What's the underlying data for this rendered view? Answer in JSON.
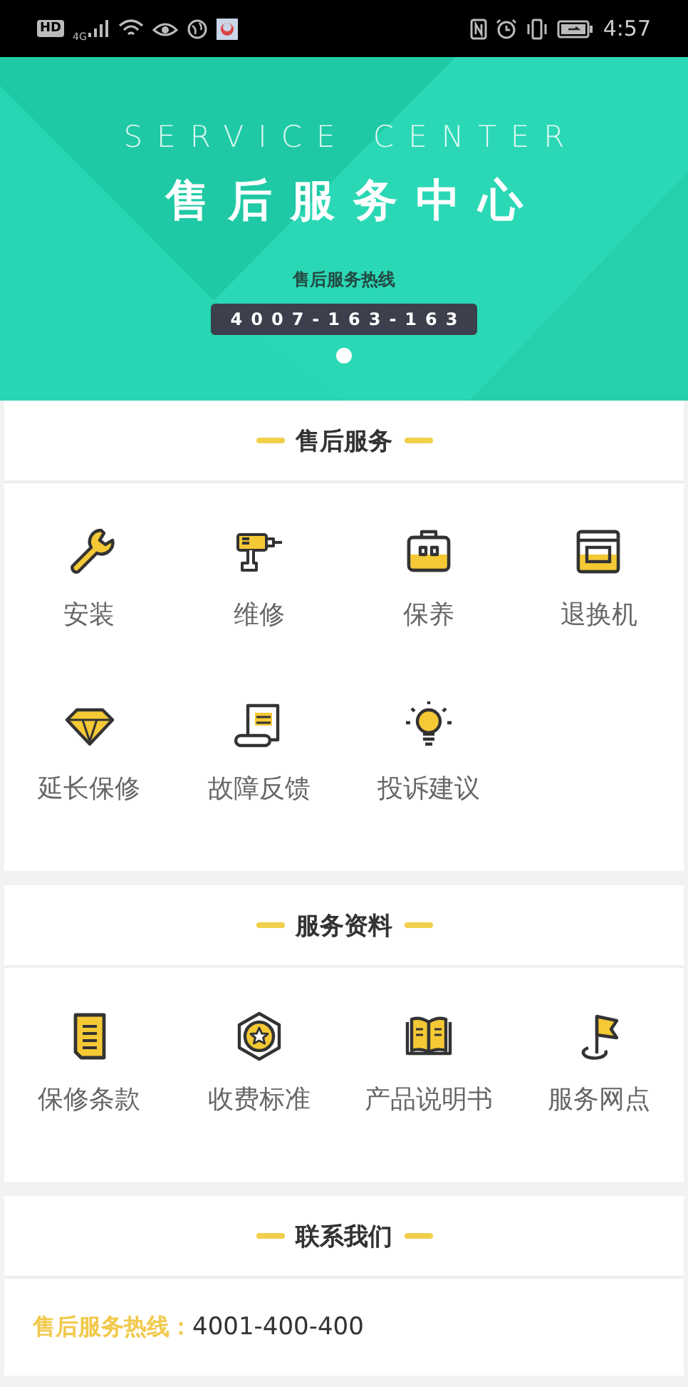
{
  "status_bar": {
    "hd": "HD",
    "network": "4G",
    "time": "4:57"
  },
  "banner": {
    "subtitle": "SERVICE CENTER",
    "title": "售后服务中心",
    "hotline_label": "售后服务热线",
    "hotline": "4007-163-163",
    "dots": [
      {
        "selected": true
      }
    ]
  },
  "sections": [
    {
      "title": "售后服务",
      "items": [
        {
          "label": "安装"
        },
        {
          "label": "维修"
        },
        {
          "label": "保养"
        },
        {
          "label": "退换机"
        },
        {
          "label": "延长保修"
        },
        {
          "label": "故障反馈"
        },
        {
          "label": "投诉建议"
        }
      ]
    },
    {
      "title": "服务资料",
      "items": [
        {
          "label": "保修条款"
        },
        {
          "label": "收费标准"
        },
        {
          "label": "产品说明书"
        },
        {
          "label": "服务网点"
        }
      ]
    }
  ],
  "contact": {
    "title": "联系我们",
    "label": "售后服务热线：",
    "value": "4001-400-400"
  }
}
